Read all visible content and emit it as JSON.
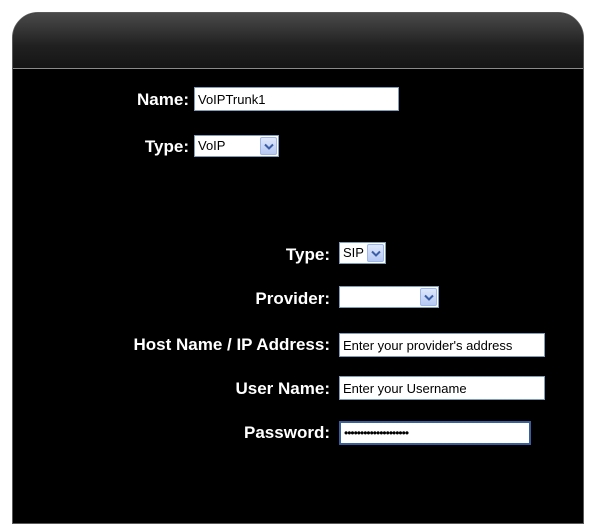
{
  "form": {
    "name_label": "Name:",
    "name_value": "VoIPTrunk1",
    "type_label": "Type:",
    "type_value": "VoIP",
    "trunk_type_label": "Type:",
    "trunk_type_value": "SIP",
    "provider_label": "Provider:",
    "provider_value": "",
    "host_label": "Host Name / IP Address:",
    "host_placeholder": "Enter your provider's address",
    "username_label": "User Name:",
    "username_placeholder": "Enter your Username",
    "password_label": "Password:",
    "password_value": "••••••••••••••••••••"
  }
}
